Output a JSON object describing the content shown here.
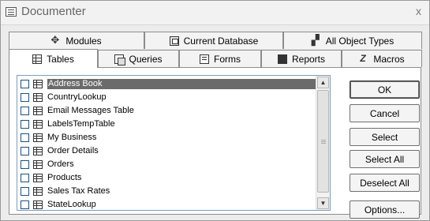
{
  "window": {
    "title": "Documenter",
    "close_glyph": "x"
  },
  "tabs_back": [
    {
      "label": "Modules",
      "icon": "modules-icon"
    },
    {
      "label": "Current Database",
      "icon": "database-icon"
    },
    {
      "label": "All Object Types",
      "icon": "object-types-icon"
    }
  ],
  "tabs_front": [
    {
      "label": "Tables",
      "icon": "table-icon",
      "active": true
    },
    {
      "label": "Queries",
      "icon": "queries-icon"
    },
    {
      "label": "Forms",
      "icon": "forms-icon"
    },
    {
      "label": "Reports",
      "icon": "reports-icon"
    },
    {
      "label": "Macros",
      "icon": "macros-icon"
    }
  ],
  "list": {
    "items": [
      {
        "label": "Address Book",
        "selected": true
      },
      {
        "label": "CountryLookup"
      },
      {
        "label": "Email Messages Table"
      },
      {
        "label": "LabelsTempTable"
      },
      {
        "label": "My Business"
      },
      {
        "label": "Order Details"
      },
      {
        "label": "Orders"
      },
      {
        "label": "Products"
      },
      {
        "label": "Sales Tax Rates"
      },
      {
        "label": "StateLookup"
      }
    ]
  },
  "buttons": {
    "ok": "OK",
    "cancel": "Cancel",
    "select": "Select",
    "select_all": "Select All",
    "deselect_all": "Deselect All",
    "options": "Options..."
  }
}
